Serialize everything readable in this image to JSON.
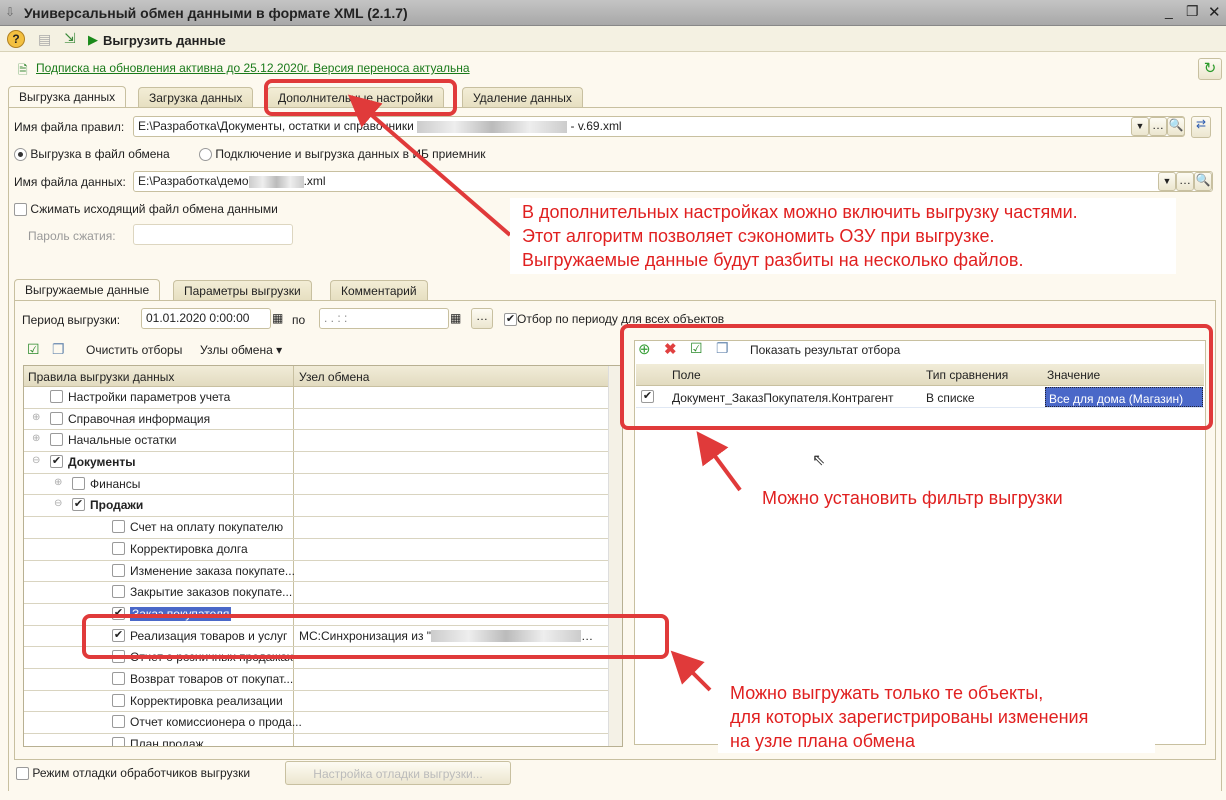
{
  "window": {
    "title": "Универсальный обмен данными в формате XML (2.1.7)"
  },
  "toolbar": {
    "export_label": "Выгрузить данные"
  },
  "subscription_link": "Подписка на обновления активна до 25.12.2020г. Версия переноса актуальна",
  "tabs": [
    {
      "label": "Выгрузка данных",
      "active": true
    },
    {
      "label": "Загрузка данных"
    },
    {
      "label": "Дополнительные настройки"
    },
    {
      "label": "Удаление данных"
    }
  ],
  "export": {
    "rules_label": "Имя файла правил:",
    "rules_value_start": "E:\\Разработка\\Документы, остатки и справочники",
    "rules_value_end": "- v.69.xml",
    "radio_file": "Выгрузка в файл обмена",
    "radio_connect": "Подключение и выгрузка данных в ИБ приемник",
    "data_label": "Имя файла данных:",
    "data_value_start": "E:\\Разработка\\демо",
    "data_value_end": ".xml",
    "compress_label": "Сжимать исходящий файл обмена данными",
    "password_label": "Пароль сжатия:"
  },
  "inner_tabs": [
    {
      "label": "Выгружаемые данные",
      "active": true
    },
    {
      "label": "Параметры выгрузки"
    },
    {
      "label": "Комментарий"
    }
  ],
  "period": {
    "label": "Период выгрузки:",
    "from": "01.01.2020  0:00:00",
    "to_label": "по",
    "to": " .  .     :  :",
    "filter_all_label": "Отбор по периоду для всех объектов",
    "filter_all_checked": true
  },
  "tree_toolbar": {
    "clear_label": "Очистить отборы",
    "nodes_label": "Узлы обмена"
  },
  "tree": {
    "headers": [
      "Правила выгрузки данных",
      "Узел обмена"
    ],
    "rows": [
      {
        "label": "Настройки параметров учета",
        "level": 0,
        "checked": false,
        "expander": "",
        "bold": false,
        "node": ""
      },
      {
        "label": "Справочная информация",
        "level": 0,
        "checked": false,
        "expander": "+",
        "bold": false,
        "node": ""
      },
      {
        "label": "Начальные остатки",
        "level": 0,
        "checked": false,
        "expander": "+",
        "bold": false,
        "node": ""
      },
      {
        "label": "Документы",
        "level": 0,
        "checked": true,
        "expander": "-",
        "bold": true,
        "node": ""
      },
      {
        "label": "Финансы",
        "level": 1,
        "checked": false,
        "expander": "+",
        "bold": false,
        "node": ""
      },
      {
        "label": "Продажи",
        "level": 1,
        "checked": true,
        "expander": "-",
        "bold": true,
        "node": ""
      },
      {
        "label": "Счет на оплату покупателю",
        "level": 2,
        "checked": false,
        "expander": "",
        "bold": false,
        "node": ""
      },
      {
        "label": "Корректировка долга",
        "level": 2,
        "checked": false,
        "expander": "",
        "bold": false,
        "node": ""
      },
      {
        "label": "Изменение заказа покупате...",
        "level": 2,
        "checked": false,
        "expander": "",
        "bold": false,
        "node": ""
      },
      {
        "label": "Закрытие заказов покупате...",
        "level": 2,
        "checked": false,
        "expander": "",
        "bold": false,
        "node": ""
      },
      {
        "label": "Заказ покупателя",
        "level": 2,
        "checked": true,
        "expander": "",
        "bold": false,
        "selected": true,
        "node": ""
      },
      {
        "label": "Реализация товаров и услуг",
        "level": 2,
        "checked": true,
        "expander": "",
        "bold": false,
        "node": "МС:Синхронизация из \""
      },
      {
        "label": "Отчет о розничных продажах",
        "level": 2,
        "checked": false,
        "expander": "",
        "bold": false,
        "node": ""
      },
      {
        "label": "Возврат товаров от покупат...",
        "level": 2,
        "checked": false,
        "expander": "",
        "bold": false,
        "node": ""
      },
      {
        "label": "Корректировка реализации",
        "level": 2,
        "checked": false,
        "expander": "",
        "bold": false,
        "node": ""
      },
      {
        "label": "Отчет комиссионера о прода...",
        "level": 2,
        "checked": false,
        "expander": "",
        "bold": false,
        "node": ""
      },
      {
        "label": "План продаж",
        "level": 2,
        "checked": false,
        "expander": "",
        "bold": false,
        "node": ""
      }
    ]
  },
  "filter": {
    "show_result_label": "Показать результат отбора",
    "headers": [
      "Поле",
      "Тип сравнения",
      "Значение"
    ],
    "rows": [
      {
        "checked": true,
        "field": "Документ_ЗаказПокупателя.Контрагент",
        "comparison": "В списке",
        "value": "Все для дома (Магазин)"
      }
    ]
  },
  "debug": {
    "label": "Режим отладки обработчиков выгрузки",
    "button": "Настройка отладки выгрузки..."
  },
  "annotations": {
    "note1": [
      "В дополнительных настройках можно включить выгрузку частями.",
      "Этот алгоритм позволяет сэкономить ОЗУ при выгрузке.",
      "Выгружаемые данные будут разбиты на несколько файлов."
    ],
    "note2": "Можно установить фильтр выгрузки",
    "note3": [
      "Можно выгружать только те объекты,",
      "для которых зарегистрированы изменения",
      "на узле плана обмена"
    ],
    "color": "#e03a3a"
  }
}
